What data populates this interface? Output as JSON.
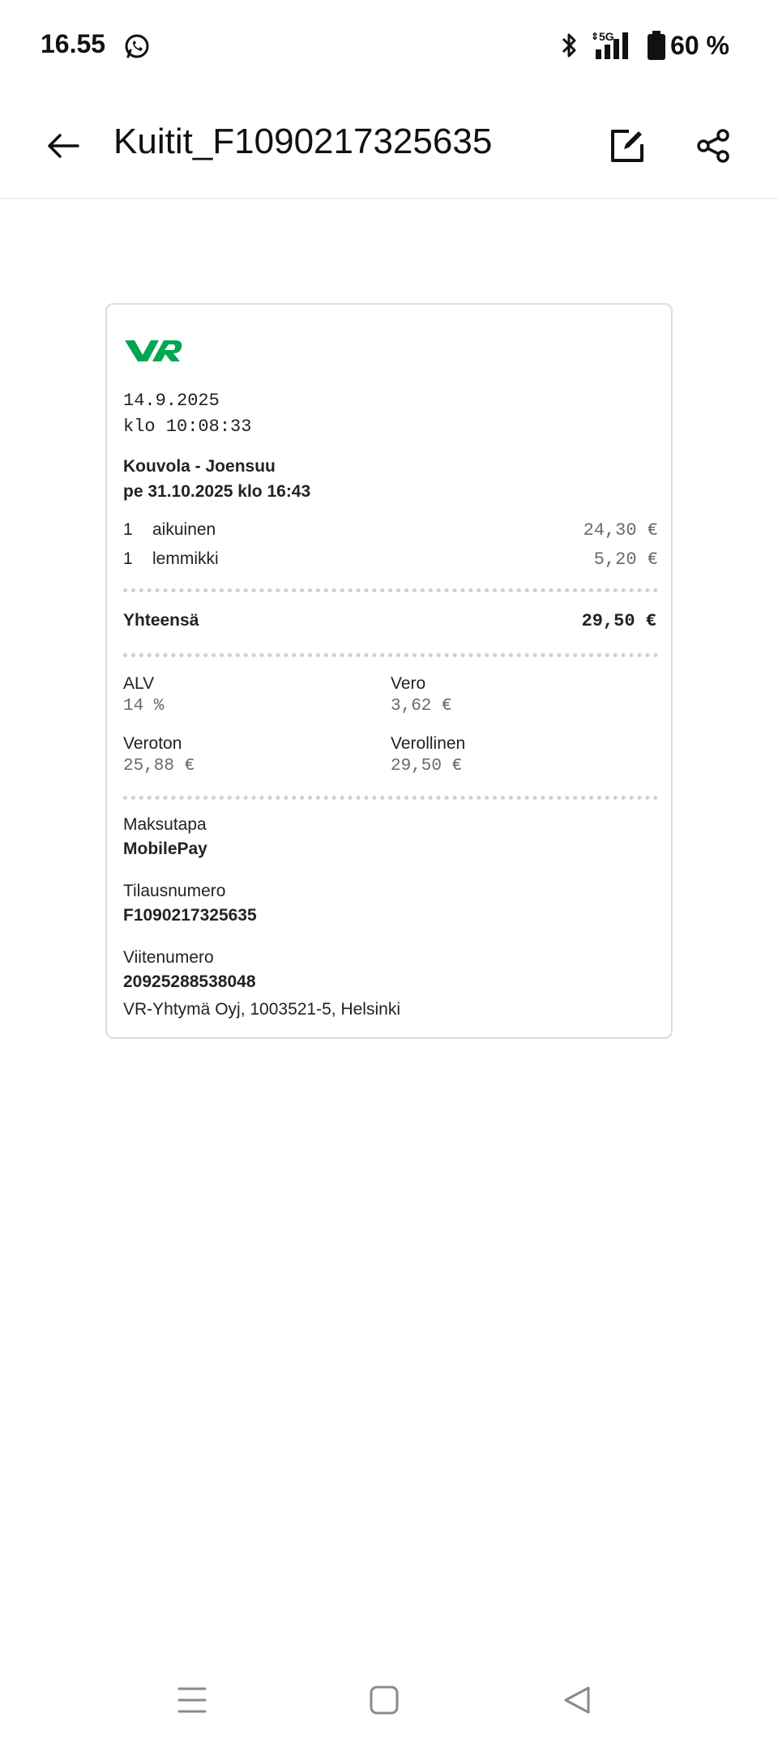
{
  "status_bar": {
    "time": "16.55",
    "network": "5G",
    "battery": "60 %",
    "icons": [
      "whatsapp-icon",
      "bluetooth-icon",
      "signal-icon",
      "battery-icon"
    ]
  },
  "app_bar": {
    "title": "Kuitit_F1090217325635",
    "icons": [
      "back-arrow-icon",
      "edit-icon",
      "share-icon"
    ]
  },
  "receipt": {
    "brand_color": "#00a651",
    "logo_text": "VR",
    "date": "14.9.2025",
    "time": "klo 10:08:33",
    "route": "Kouvola - Joensuu",
    "departure": "pe 31.10.2025 klo 16:43",
    "items": [
      {
        "qty": "1",
        "name": "aikuinen",
        "price": "24,30 €"
      },
      {
        "qty": "1",
        "name": "lemmikki",
        "price": "5,20 €"
      }
    ],
    "total_label": "Yhteensä",
    "total_value": "29,50 €",
    "tax": {
      "alv_label": "ALV",
      "alv_value": "14 %",
      "vero_label": "Vero",
      "vero_value": "3,62 €",
      "veroton_label": "Veroton",
      "veroton_value": "25,88 €",
      "verollinen_label": "Verollinen",
      "verollinen_value": "29,50 €"
    },
    "payment_label": "Maksutapa",
    "payment_value": "MobilePay",
    "order_label": "Tilausnumero",
    "order_value": "F1090217325635",
    "reference_label": "Viitenumero",
    "reference_value": "20925288538048",
    "company": "VR-Yhtymä Oyj, 1003521-5, Helsinki"
  },
  "nav_bar": {
    "icons": [
      "menu-icon",
      "home-icon",
      "back-icon"
    ]
  }
}
